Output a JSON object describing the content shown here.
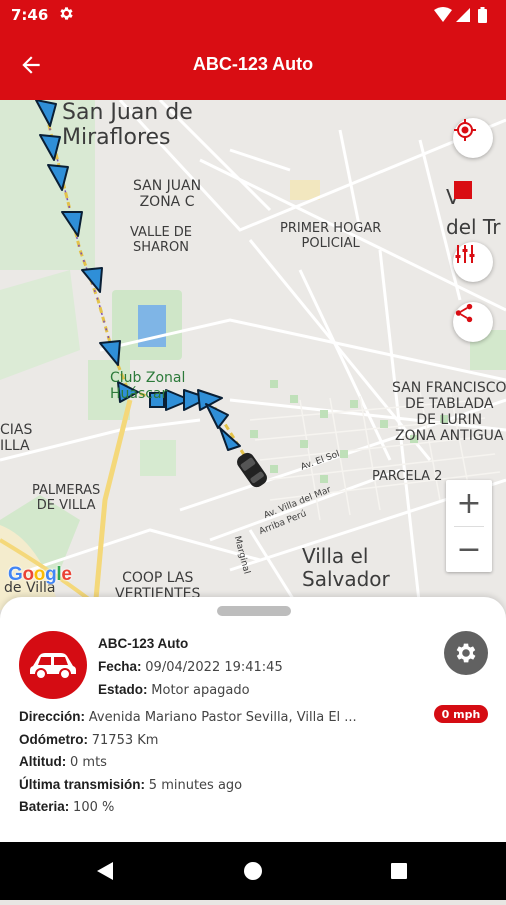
{
  "status_bar": {
    "time": "7:46"
  },
  "app_bar": {
    "title": "ABC-123 Auto"
  },
  "map": {
    "labels": {
      "san_juan": "San Juan de\nMiraflores",
      "san_juan_zona_c": "SAN JUAN\nZONA C",
      "valle_sharon": "VALLE DE\nSHARON",
      "primer_hogar": "PRIMER HOGAR\nPOLICIAL",
      "club_zonal": "Club Zonal\nHuáscar",
      "san_francisco": "SAN FRANCISCO\nDE TABLADA\nDE LURIN\nZONA ANTIGUA",
      "parcela": "PARCELA 2",
      "cias_villa": "CIAS\nILLA",
      "palmeras": "PALMERAS\nDE VILLA",
      "coop_las": "COOP LAS\nVERTIENTES",
      "villa_salvador": "Villa el\nSalvador",
      "de_villa": "de Villa",
      "villa_del_mar": "Av. Villa del Mar",
      "arriba_peru": "Arriba Perú",
      "el_sol": "Av. El Sol",
      "marginal": "Marginal",
      "cut_top": "V        M",
      "cut_bottom": "del Tr"
    },
    "google_logo": "Google",
    "zoom_in": "+",
    "zoom_out": "−"
  },
  "vehicle": {
    "name": "ABC-123 Auto",
    "fecha_label": "Fecha:",
    "fecha_value": "09/04/2022 19:41:45",
    "estado_label": "Estado:",
    "estado_value": "Motor apagado",
    "direccion_label": "Dirección:",
    "direccion_value": "Avenida Mariano Pastor Sevilla, Villa El ...",
    "speed": "0 mph",
    "odometro_label": "Odómetro:",
    "odometro_value": "71753 Km",
    "altitud_label": "Altitud:",
    "altitud_value": "0 mts",
    "ultima_label": "Última transmisión:",
    "ultima_value": "5 minutes ago",
    "bateria_label": "Bateria:",
    "bateria_value": "100 %"
  },
  "colors": {
    "brand": "#d90d13",
    "route_arrow": "#2f8fd8",
    "route_line": "#e3c24a"
  },
  "icons": [
    "settings-gear-icon",
    "wifi-icon",
    "signal-icon",
    "battery-icon",
    "back-arrow-icon",
    "my-location-icon",
    "stop-icon",
    "filter-icon",
    "share-icon",
    "car-icon",
    "gear-icon",
    "back-triangle-icon",
    "home-circle-icon",
    "recents-square-icon"
  ]
}
